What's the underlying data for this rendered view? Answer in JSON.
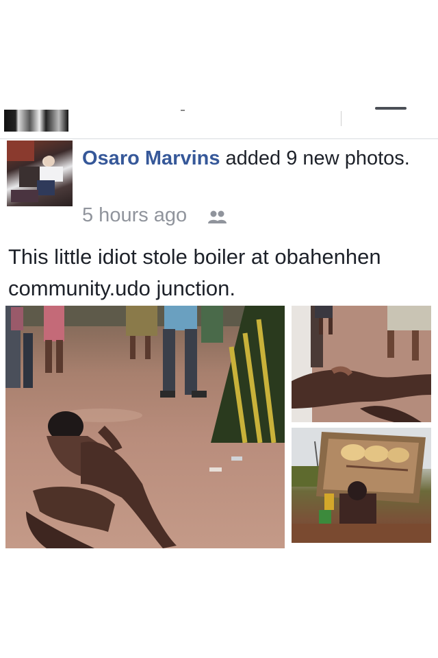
{
  "post": {
    "author": "Osaro Marvins",
    "action": "added 9 new photos.",
    "timestamp": "5 hours ago",
    "privacy_icon": "friends-icon",
    "caption": "This little idiot stole boiler at obahenhen community.udo junction."
  },
  "photos": [
    {
      "id": "main",
      "description_icon": "photo"
    },
    {
      "id": "top-right",
      "description_icon": "photo"
    },
    {
      "id": "bottom-right",
      "description_icon": "photo"
    }
  ],
  "colors": {
    "author_link": "#365899",
    "text": "#1d2129",
    "meta": "#90949c",
    "divider": "#d8dbe0"
  }
}
